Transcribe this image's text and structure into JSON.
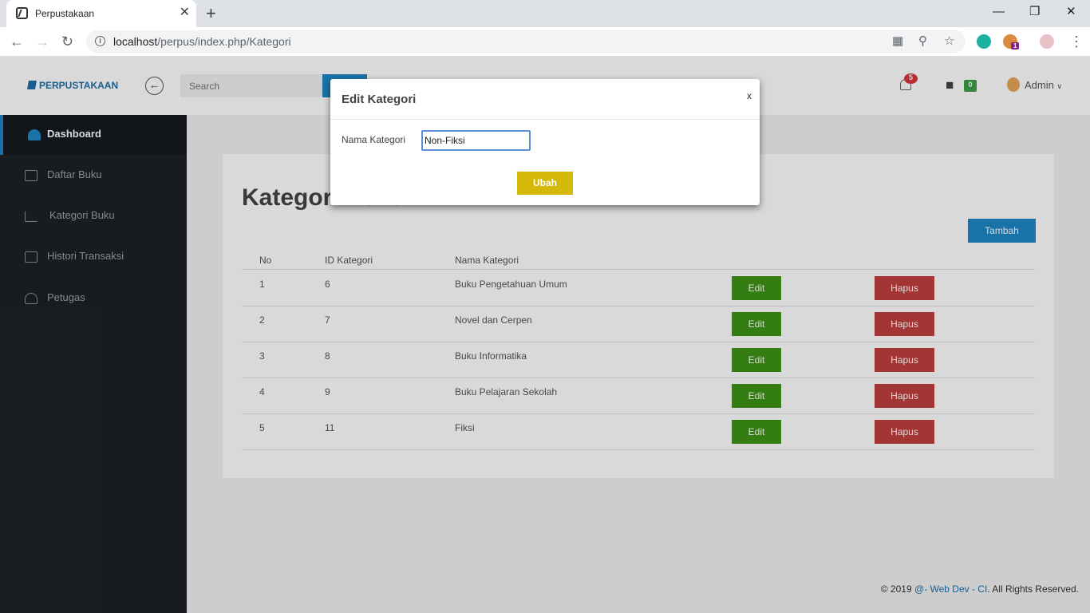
{
  "browser": {
    "tab_title": "Perpustakaan",
    "tab_close": "✕",
    "new_tab": "+",
    "url_host": "localhost",
    "url_path": "/perpus/index.php/Kategori",
    "ext_badge": "1"
  },
  "topnav": {
    "brand": "PERPUSTAKAAN",
    "search_placeholder": "Search",
    "notif_count": "5",
    "cart_count": "0",
    "user": "Admin"
  },
  "sidebar": {
    "items": [
      {
        "label": "Dashboard"
      },
      {
        "label": "Daftar Buku"
      },
      {
        "label": "Kategori Buku"
      },
      {
        "label": "Histori Transaksi"
      },
      {
        "label": "Petugas"
      }
    ]
  },
  "main": {
    "title": "Kategori Buku",
    "add_label": "Tambah",
    "columns": [
      "No",
      "ID Kategori",
      "Nama Kategori"
    ],
    "edit_label": "Edit",
    "delete_label": "Hapus",
    "rows": [
      {
        "no": "1",
        "id": "6",
        "name": "Buku Pengetahuan Umum"
      },
      {
        "no": "2",
        "id": "7",
        "name": "Novel dan Cerpen"
      },
      {
        "no": "3",
        "id": "8",
        "name": "Buku Informatika"
      },
      {
        "no": "4",
        "id": "9",
        "name": "Buku Pelajaran Sekolah"
      },
      {
        "no": "5",
        "id": "11",
        "name": "Fiksi"
      }
    ]
  },
  "modal": {
    "title": "Edit Kategori",
    "close": "x",
    "field_label": "Nama Kategori",
    "field_value": "Non-Fiksi",
    "submit_label": "Ubah"
  },
  "footer": {
    "prefix": "© 2019 ",
    "link": "@- Web Dev - CI",
    "suffix": ". All Rights Reserved."
  },
  "colors": {
    "primary": "#1e88c7",
    "success": "#3e9317",
    "danger": "#c0403f",
    "warning": "#d4b80a",
    "sidebar": "#1d2127"
  }
}
